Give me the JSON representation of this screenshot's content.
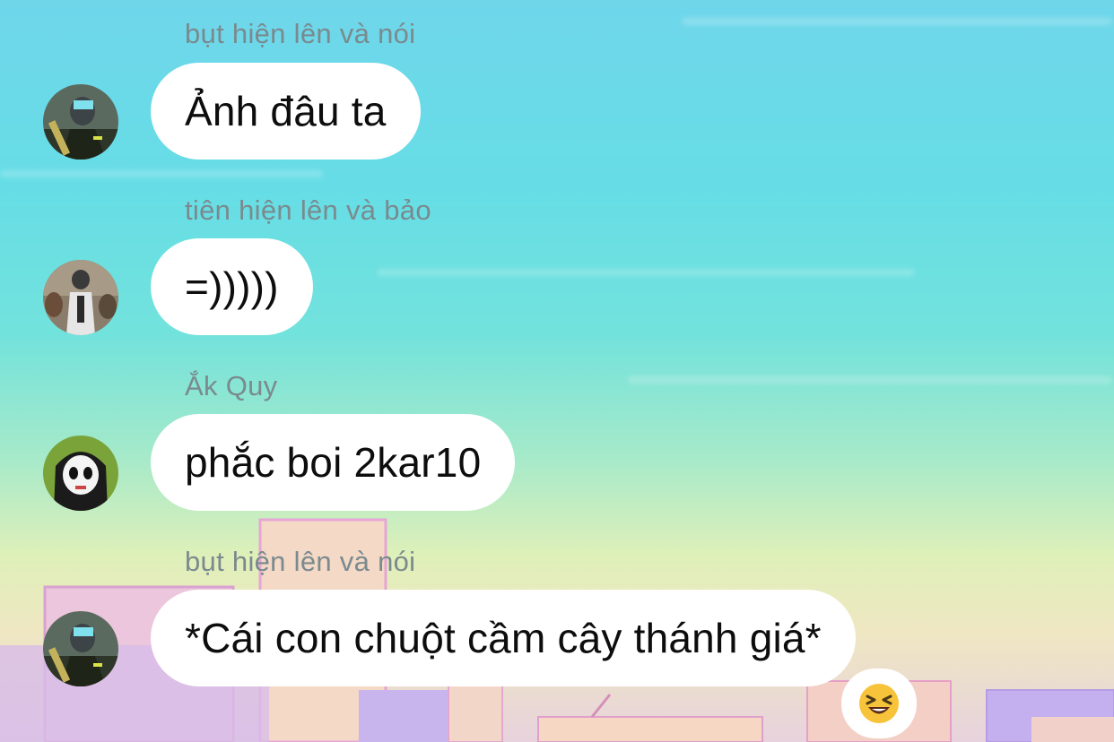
{
  "messages": [
    {
      "sender": "bụt hiện lên và nói",
      "text": "Ảnh đâu ta",
      "avatar": "avatar-armored-soldier"
    },
    {
      "sender": "tiên hiện lên và bảo",
      "text": "=)))))",
      "avatar": "avatar-pubg-character"
    },
    {
      "sender": "Ắk Quy",
      "text": "phắc boi 2kar10",
      "avatar": "avatar-skull-hoodie"
    },
    {
      "sender": "bụt hiện lên và nói",
      "text": "*Cái con chuột cầm cây thánh giá*",
      "avatar": "avatar-armored-soldier"
    }
  ],
  "reaction": {
    "emoji": "😆",
    "icon": "laughing-face-icon"
  },
  "colors": {
    "sender_text": "#7a8a8e",
    "bubble_bg": "#ffffff",
    "message_text": "#0d0d0d"
  }
}
